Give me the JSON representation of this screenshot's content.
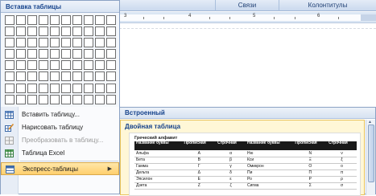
{
  "ribbon": {
    "groups": [
      {
        "label": ""
      },
      {
        "label": "Связи"
      },
      {
        "label": "Колонтитулы"
      }
    ]
  },
  "ruler": {
    "numbers": [
      "3",
      "4",
      "5",
      "6"
    ]
  },
  "grid_panel": {
    "title": "Вставка таблицы",
    "columns": 10,
    "rows": 8
  },
  "menu": {
    "items": [
      {
        "label": "Вставить таблицу...",
        "icon": "insert-table-icon",
        "enabled": true
      },
      {
        "label": "Нарисовать таблицу",
        "icon": "draw-table-pencil-icon",
        "enabled": true
      },
      {
        "label": "Преобразовать в таблицу...",
        "icon": "convert-to-table-icon",
        "enabled": false
      },
      {
        "label": "Таблица Excel",
        "icon": "excel-table-icon",
        "enabled": true
      },
      {
        "label": "Экспресс-таблицы",
        "icon": "quick-tables-icon",
        "enabled": true,
        "has_submenu": true
      }
    ],
    "submenu_arrow": "▶"
  },
  "flyout": {
    "section_title": "Встроенный",
    "preview_name": "Двойная таблица",
    "caption": "Греческий алфавит",
    "headers": [
      "Название буквы",
      "Прописная",
      "Строчная",
      "Название буквы",
      "Прописная",
      "Строчная"
    ],
    "rows": [
      [
        "Альфа",
        "Α",
        "α",
        "Ню",
        "Ν",
        "ν"
      ],
      [
        "Бета",
        "Β",
        "β",
        "Кси",
        "Ξ",
        "ξ"
      ],
      [
        "Гамма",
        "Γ",
        "γ",
        "Омикрон",
        "Ο",
        "ο"
      ],
      [
        "Дельта",
        "Δ",
        "δ",
        "Пи",
        "Π",
        "π"
      ],
      [
        "Эпсилон",
        "Ε",
        "ε",
        "Ро",
        "Ρ",
        "ρ"
      ],
      [
        "Дзета",
        "Ζ",
        "ζ",
        "Сигма",
        "Σ",
        "σ"
      ]
    ]
  },
  "colors": {
    "accent": "#15428b",
    "highlight": "#ffcf6e",
    "border": "#8ba2c4"
  }
}
